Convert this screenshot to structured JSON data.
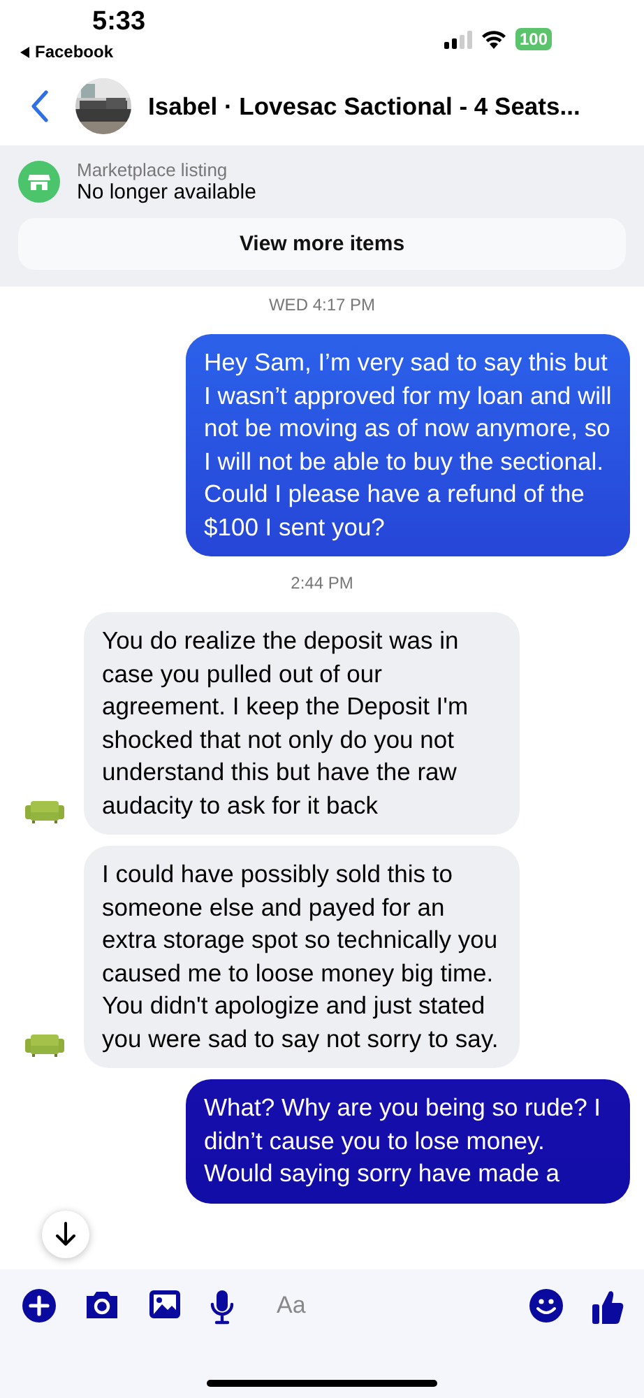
{
  "status_bar": {
    "time": "5:33",
    "back_app": "Facebook",
    "battery": "100"
  },
  "header": {
    "title": "Isabel · Lovesac Sactional - 4 Seats..."
  },
  "listing": {
    "label": "Marketplace listing",
    "status": "No longer available",
    "button": "View more items"
  },
  "messages": [
    {
      "kind": "timestamp",
      "text": "WED 4:17 PM"
    },
    {
      "kind": "outgoing",
      "text": "Hey Sam, I’m very sad to say this but I wasn’t approved for my loan and will not be moving as of now anymore, so I will not be able to buy the sectional. Could I please have a refund of the $100 I sent you?"
    },
    {
      "kind": "timestamp",
      "text": "2:44 PM"
    },
    {
      "kind": "incoming",
      "text": "You do realize the deposit was in case you pulled out of our agreement. I keep the Deposit  I'm shocked that not only do you not understand this but have the raw audacity to ask for it back"
    },
    {
      "kind": "incoming",
      "text": "I could have possibly sold this to someone else and payed for an extra storage spot so technically you caused me to loose money big time. You didn't apologize and just stated you were sad to say not sorry to say."
    },
    {
      "kind": "outgoing",
      "text": "What? Why are you being so rude? I didn’t cause you to lose money. Would saying sorry have made a"
    }
  ],
  "composer": {
    "placeholder": "Aa"
  }
}
